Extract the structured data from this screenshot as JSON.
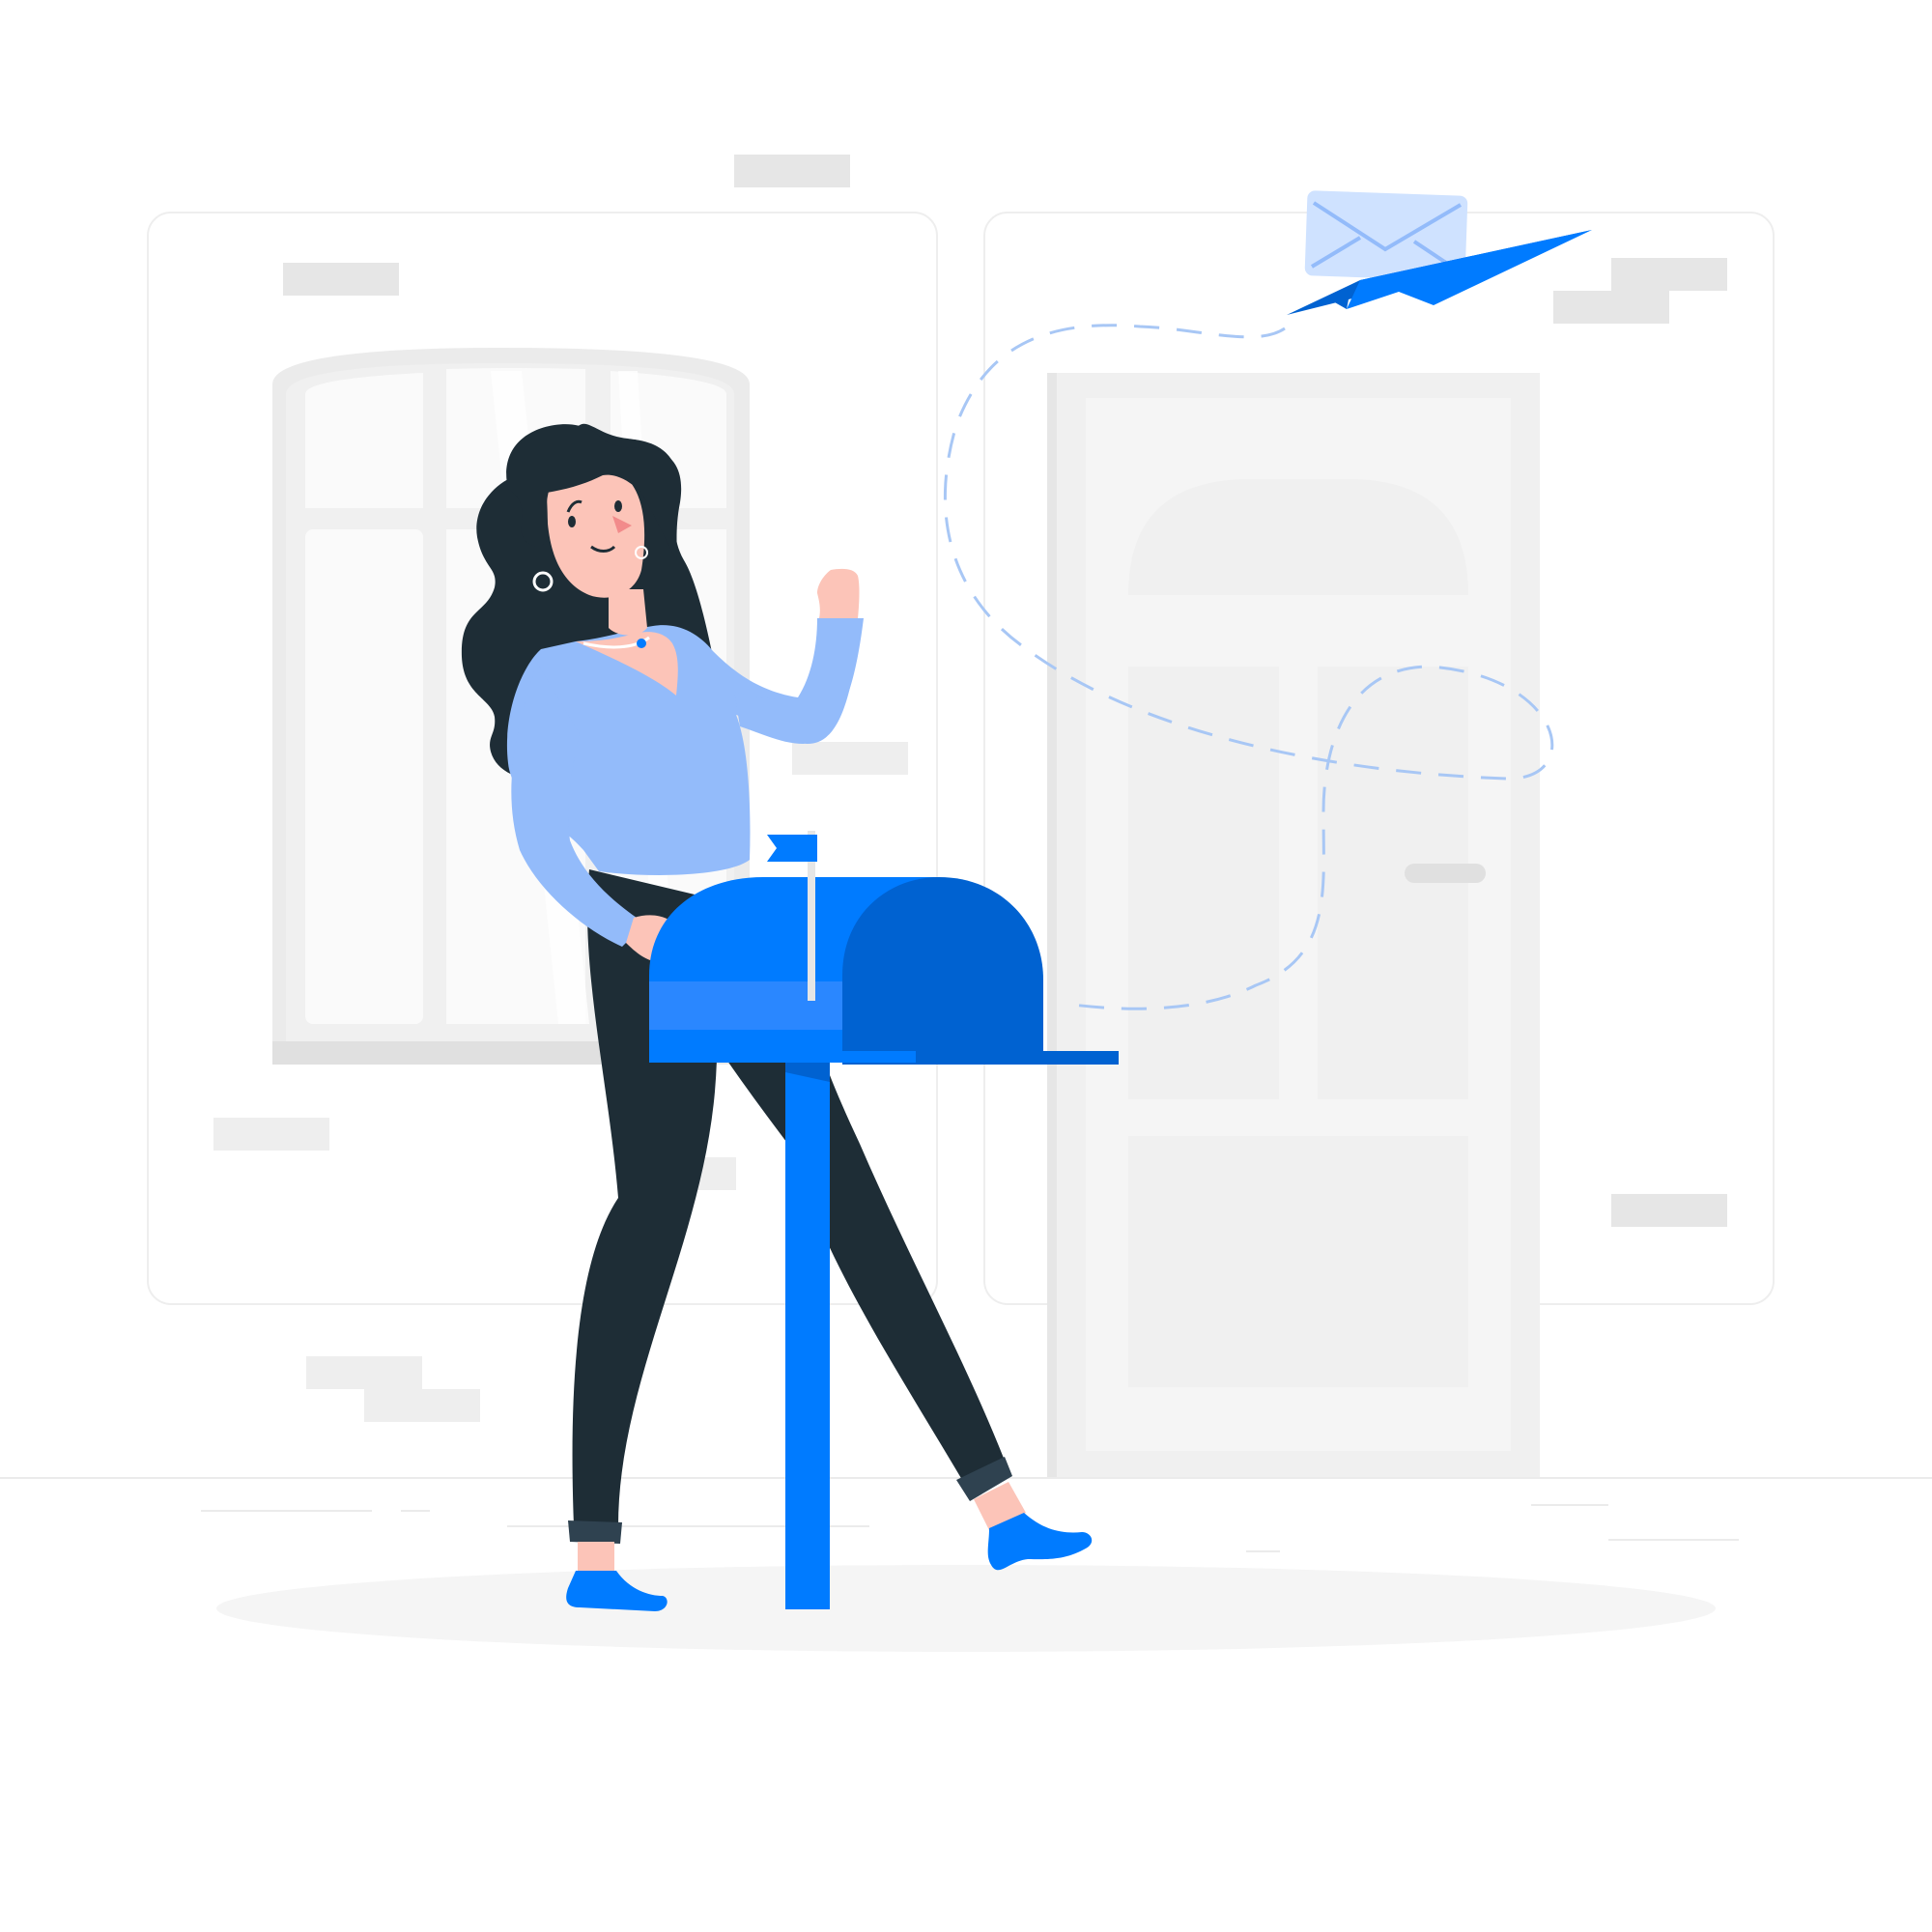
{
  "illustration": {
    "subject": "woman-waving-beside-mailbox-with-paper-plane-envelope",
    "icons": [
      "envelope-icon",
      "paper-plane-icon",
      "mailbox-flag-icon"
    ]
  },
  "colors": {
    "background": "#ffffff",
    "wall_panel_stroke": "#eeeeee",
    "light_gray": "#f5f5f5",
    "mid_gray": "#ebebeb",
    "brick_gray": "#e6e6e6",
    "primary_blue": "#007bff",
    "dark_blue": "#0062d1",
    "sweater_blue": "#93bbfa",
    "envelope_light": "#cfe2ff",
    "envelope_line": "#93bbfa",
    "hair_dark": "#1e2d36",
    "skin": "#fcc4b8",
    "flight_path": "#a8c7f5"
  }
}
